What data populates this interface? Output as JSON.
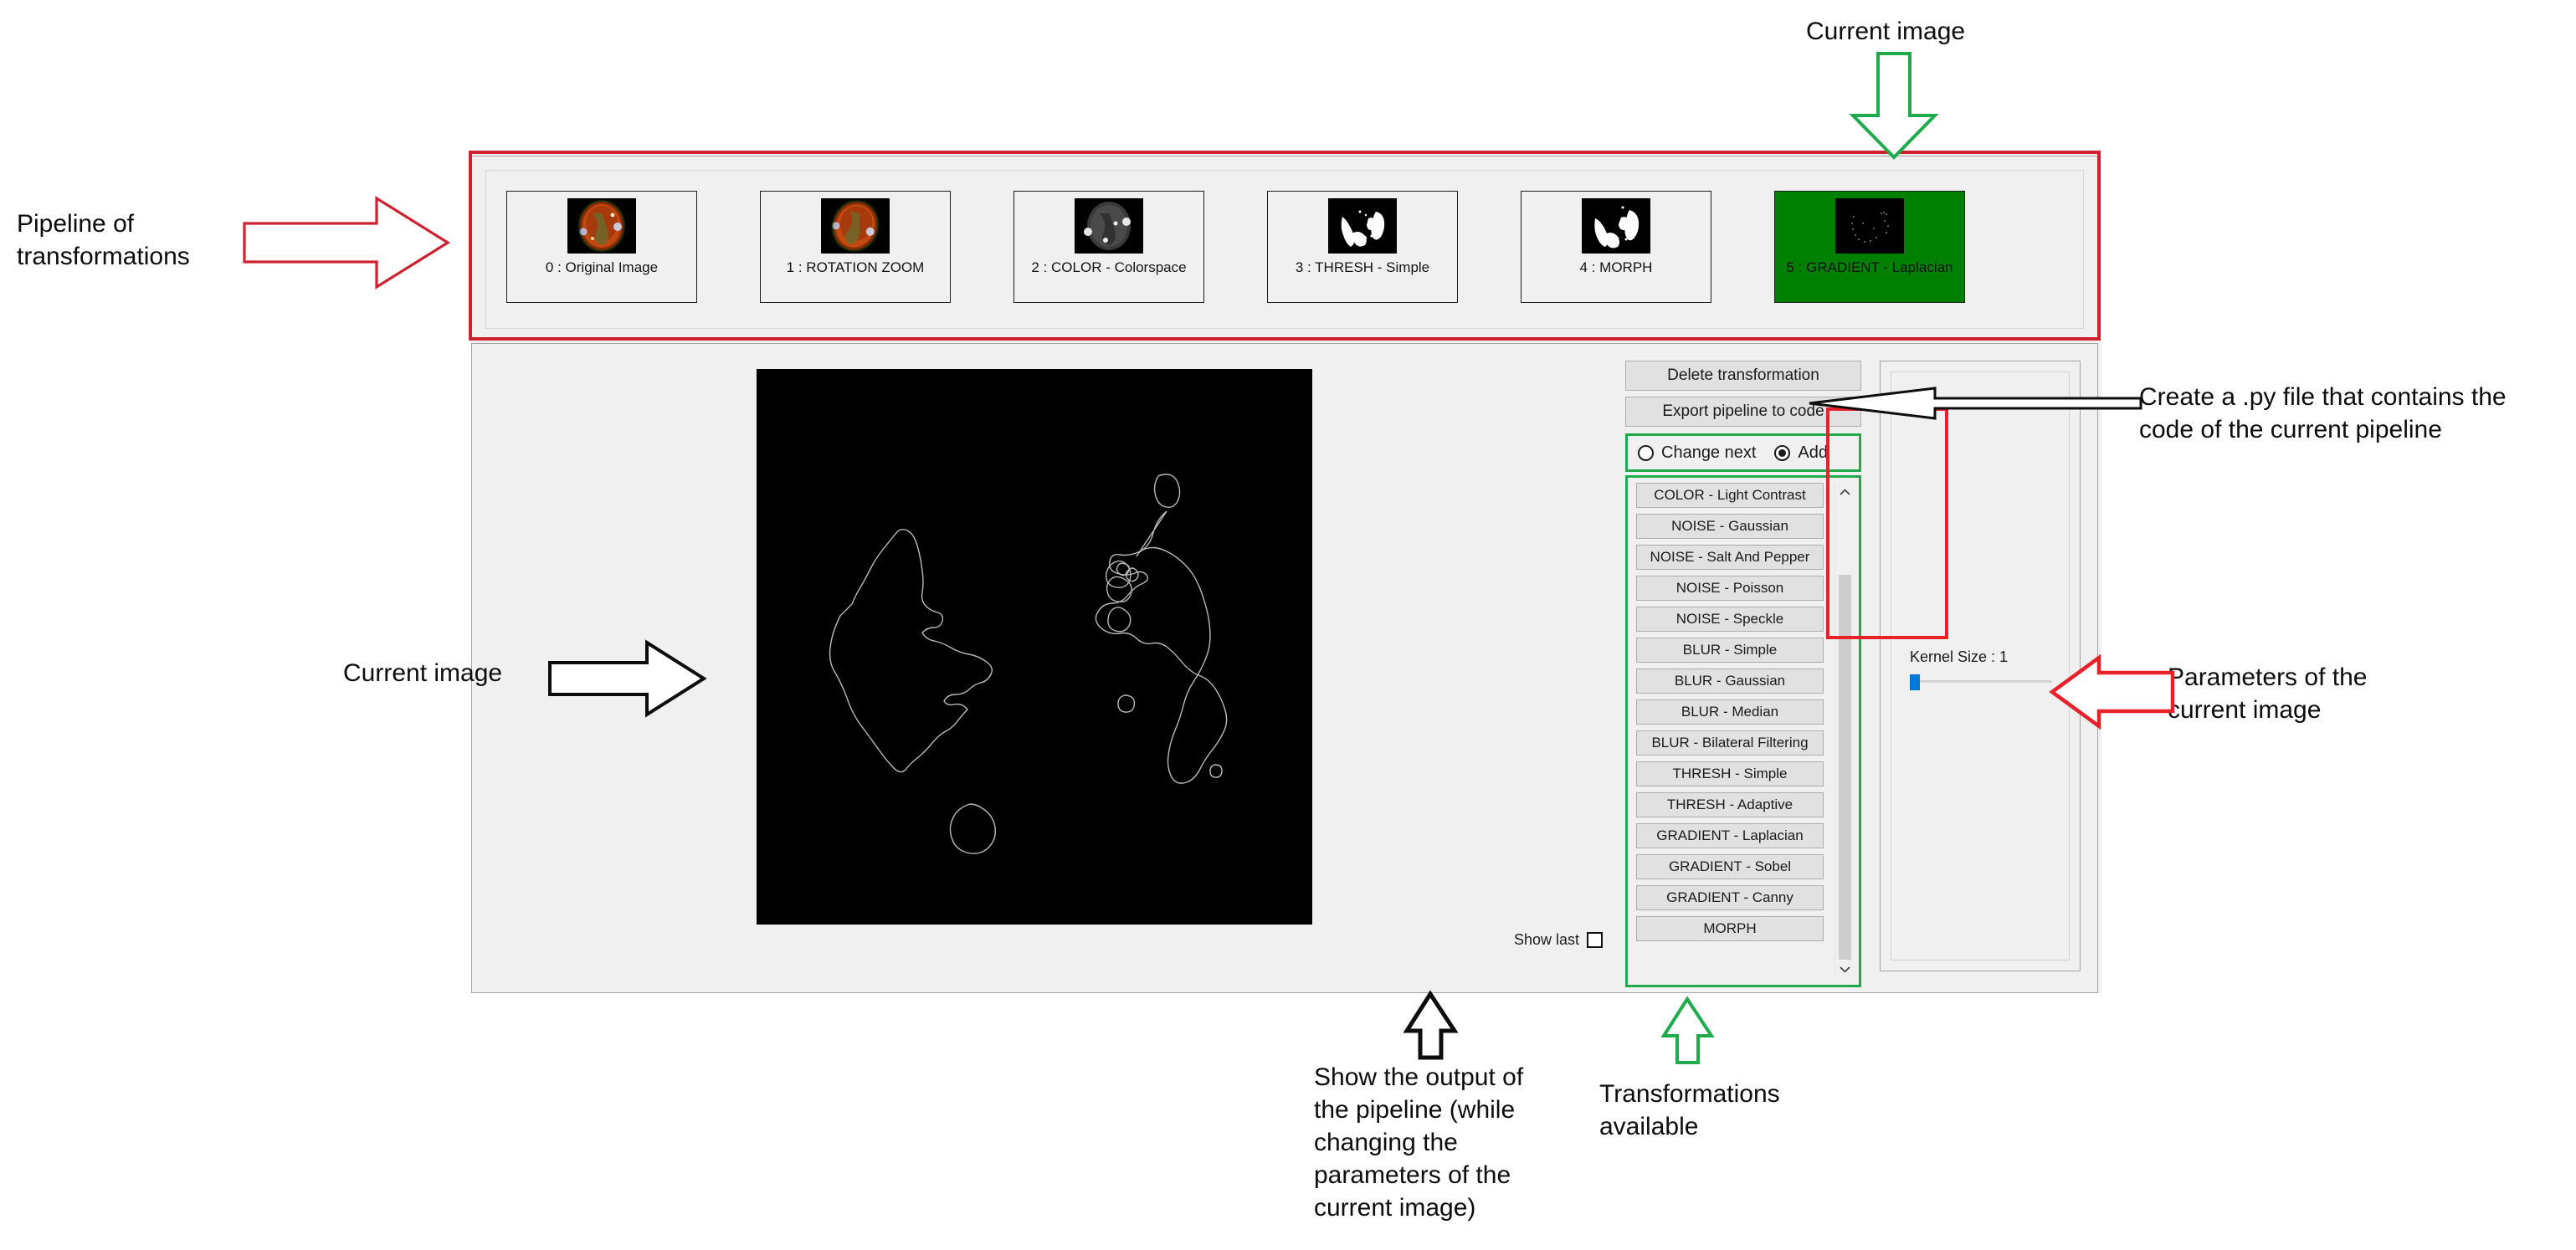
{
  "app": {
    "pipeline": {
      "items": [
        {
          "index": "0",
          "label": "0 : Original Image",
          "kind": "color-sun",
          "selected": false
        },
        {
          "index": "1",
          "label": "1 : ROTATION ZOOM",
          "kind": "color-sun-rot",
          "selected": false
        },
        {
          "index": "2",
          "label": "2 : COLOR - Colorspace",
          "kind": "gray-sun",
          "selected": false
        },
        {
          "index": "3",
          "label": "3 : THRESH - Simple",
          "kind": "binary",
          "selected": false
        },
        {
          "index": "4",
          "label": "4 : MORPH",
          "kind": "binary-morph",
          "selected": false
        },
        {
          "index": "5",
          "label": "5 : GRADIENT - Laplacian",
          "kind": "edges",
          "selected": true
        }
      ]
    },
    "preview": {
      "show_last_label": "Show last",
      "show_last_checked": false,
      "dimensions": "h : 1920, w : 1920"
    },
    "controls": {
      "delete_label": "Delete transformation",
      "export_label": "Export pipeline to code",
      "mode": {
        "change_next_label": "Change next",
        "add_label": "Add",
        "selected": "Add"
      },
      "transformations": [
        "COLOR - Light Contrast",
        "NOISE - Gaussian",
        "NOISE - Salt And Pepper",
        "NOISE - Poisson",
        "NOISE - Speckle",
        "BLUR - Simple",
        "BLUR - Gaussian",
        "BLUR - Median",
        "BLUR - Bilateral Filtering",
        "THRESH - Simple",
        "THRESH - Adaptive",
        "GRADIENT - Laplacian",
        "GRADIENT - Sobel",
        "GRADIENT - Canny",
        "MORPH"
      ],
      "scroll_up_icon": "chevron-up-icon",
      "scroll_down_icon": "chevron-down-icon"
    },
    "parameters": {
      "kernel_size_label": "Kernel Size : 1",
      "kernel_size_value": 1,
      "kernel_size_min": 1,
      "kernel_size_max": 31
    }
  },
  "annotations": [
    {
      "id": "pipeline-of-transformations",
      "text": "Pipeline of\ntransformations",
      "arrow_color": "#cf2230"
    },
    {
      "id": "current-image-top",
      "text": "Current image",
      "arrow_color": "#1faa4b"
    },
    {
      "id": "current-image-left",
      "text": "Current image",
      "arrow_color": "#000000"
    },
    {
      "id": "export-note",
      "text": "Create a .py file that contains the\ncode of the current pipeline",
      "arrow_color": "#000000"
    },
    {
      "id": "parameters-note",
      "text": "Parameters of the\ncurrent image",
      "arrow_color": "#e8202a"
    },
    {
      "id": "show-last-note",
      "text": "Show the output of\nthe pipeline (while\nchanging the\nparameters of the\ncurrent image)",
      "arrow_color": "#000000"
    },
    {
      "id": "transformations-note",
      "text": "Transformations\navailable",
      "arrow_color": "#1faa4b"
    }
  ],
  "colors": {
    "selected_thumb": "#008000",
    "highlight_red": "#e8202a",
    "highlight_green": "#1faa4b",
    "slider_blue": "#0078d7",
    "window_bg": "#f0f0f0"
  }
}
